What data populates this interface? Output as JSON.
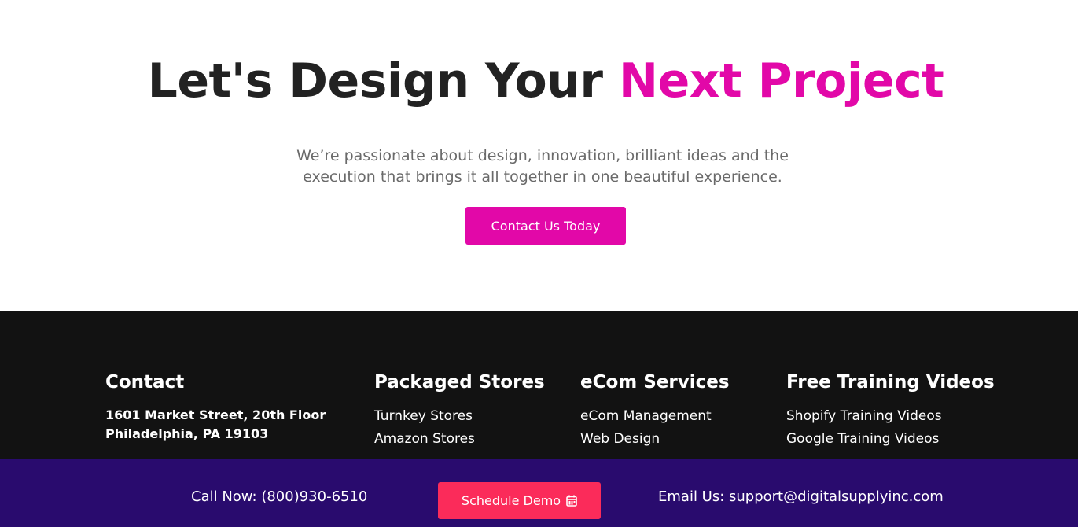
{
  "hero": {
    "title_main": "Let's Design Your ",
    "title_accent": "Next Project",
    "subtitle_line1": "We’re passionate about design, innovation, brilliant ideas and the",
    "subtitle_line2": "execution that brings it all together in one beautiful experience.",
    "cta_label": "Contact Us Today"
  },
  "footer": {
    "contact": {
      "heading": "Contact",
      "address_line1": "1601 Market Street, 20th Floor",
      "address_line2": "Philadelphia, PA 19103"
    },
    "packaged_stores": {
      "heading": "Packaged Stores",
      "items": [
        "Turnkey Stores",
        "Amazon Stores"
      ]
    },
    "ecom_services": {
      "heading": "eCom Services",
      "items": [
        "eCom Management",
        "Web Design"
      ]
    },
    "free_training": {
      "heading": "Free Training Videos",
      "items": [
        "Shopify Training Videos",
        "Google Training Videos"
      ]
    }
  },
  "sticky_bar": {
    "call_text": "Call Now: (800)930-6510",
    "demo_label": "Schedule Demo",
    "demo_icon": "calendar-icon",
    "email_text": "Email Us: support@digitalsupplyinc.com"
  },
  "colors": {
    "accent": "#e208a8",
    "footer_bg": "#121212",
    "sticky_bg": "#290b6e",
    "demo_button": "#fb2b5a"
  }
}
